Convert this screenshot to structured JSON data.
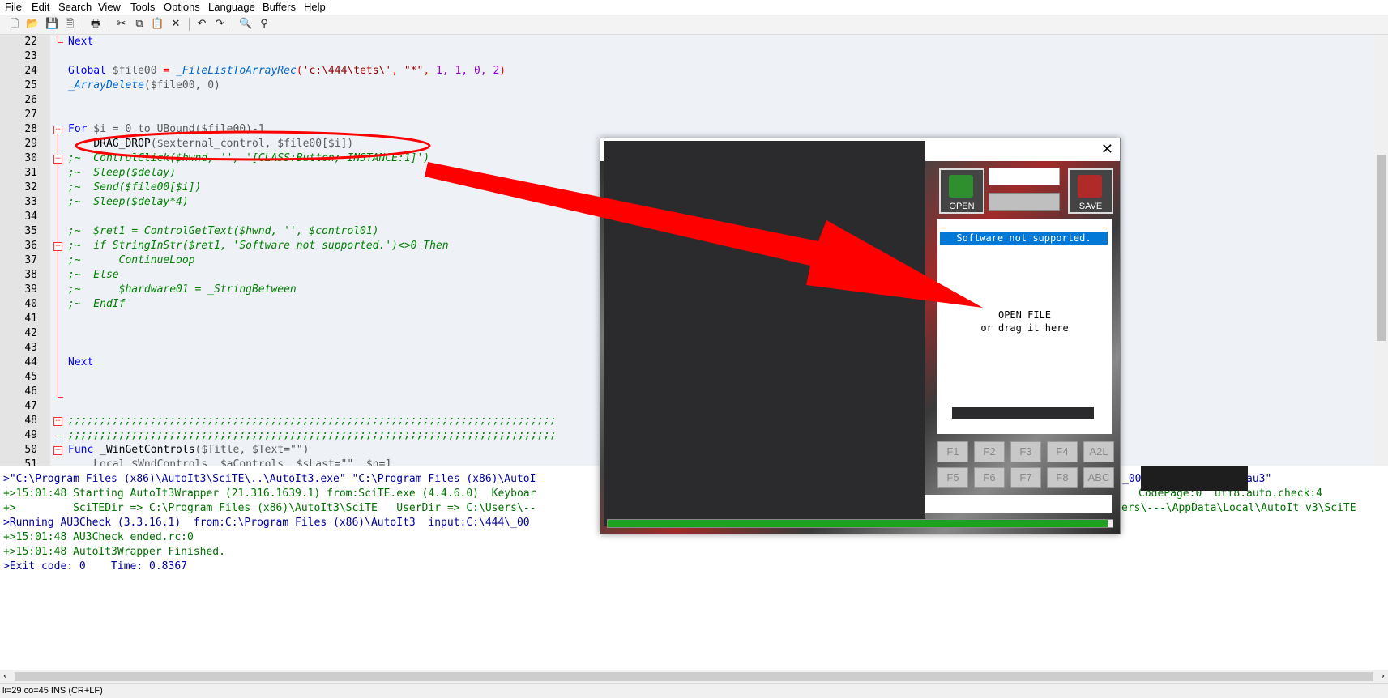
{
  "menu": [
    "File",
    "Edit",
    "Search",
    "View",
    "Tools",
    "Options",
    "Language",
    "Buffers",
    "Help"
  ],
  "toolbar_icons": [
    "new-file-icon",
    "open-folder-icon",
    "save-icon",
    "close-file-icon",
    "print-icon",
    "cut-icon",
    "copy-icon",
    "paste-icon",
    "delete-icon",
    "undo-icon",
    "redo-icon",
    "find-icon",
    "replace-icon"
  ],
  "editor": {
    "lines": [
      {
        "num": "22"
      },
      {
        "num": "23"
      },
      {
        "num": "24"
      },
      {
        "num": "25"
      },
      {
        "num": "26"
      },
      {
        "num": "27"
      },
      {
        "num": "28"
      },
      {
        "num": "29"
      },
      {
        "num": "30"
      },
      {
        "num": "31"
      },
      {
        "num": "32"
      },
      {
        "num": "33"
      },
      {
        "num": "34"
      },
      {
        "num": "35"
      },
      {
        "num": "36"
      },
      {
        "num": "37"
      },
      {
        "num": "38"
      },
      {
        "num": "39"
      },
      {
        "num": "40"
      },
      {
        "num": "41"
      },
      {
        "num": "42"
      },
      {
        "num": "43"
      },
      {
        "num": "44"
      },
      {
        "num": "45"
      },
      {
        "num": "46"
      },
      {
        "num": "47"
      },
      {
        "num": "48"
      },
      {
        "num": "49"
      },
      {
        "num": "50"
      },
      {
        "num": "51"
      }
    ],
    "code": {
      "l22": "Next",
      "l24_kw": "Global",
      "l24_var": " $file00 ",
      "l24_op": "=",
      "l24_fn": " _FileListToArrayRec",
      "l24_p1": "(",
      "l24_s1": "'c:\\444\\tets\\'",
      "l24_c1": ", ",
      "l24_s2": "\"*\"",
      "l24_c2": ", ",
      "l24_n": "1, 1, 0, 2",
      "l24_p2": ")",
      "l25_fn": "_ArrayDelete",
      "l25_rest": "($file00, 0)",
      "l28_kw": "For",
      "l28_rest": " $i = 0 to UBound($file00)-1",
      "l29_fn": "DRAG_DROP",
      "l29_rest": "($external_control, $file00[$i])",
      "l30": ";~  ControlClick($hwnd, '', '[CLASS:Button; INSTANCE:1]')",
      "l31": ";~  Sleep($delay)",
      "l32": ";~  Send($file00[$i])",
      "l33": ";~  Sleep($delay*4)",
      "l35": ";~  $ret1 = ControlGetText($hwnd, '', $control01)",
      "l36": ";~  if StringInStr($ret1, 'Software not supported.')<>0 Then",
      "l37": ";~      ContinueLoop",
      "l38": ";~  Else",
      "l39": ";~      $hardware01 = _StringBetween",
      "l40": ";~  EndIf",
      "l44": "Next",
      "l48": ";;;;;;;;;;;;;;;;;;;;;;;;;;;;;;;;;;;;;;;;;;;;;;;;;;;;;;;;;;;;;;;;;;;;;;;;;;;;;",
      "l49": ";;;;;;;;;;;;;;;;;;;;;;;;;;;;;;;;;;;;;;;;;;;;;;;;;;;;;;;;;;;;;;;;;;;;;;;;;;;;;",
      "l50_kw": "Func",
      "l50_fn": " _WinGetControls",
      "l50_rest": "($Title, $Text=\"\")",
      "l51": "    Local $WndControls, $aControls, $sLast=\"\", $n=1"
    }
  },
  "output": {
    "lines": [
      ">\"C:\\Program Files (x86)\\AutoIt3\\SciTE\\..\\AutoIt3.exe\" \"C:\\Program Files (x86)\\AutoI",
      "+>15:01:48 Starting AutoIt3Wrapper (21.316.1639.1) from:SciTE.exe (4.4.6.0)  Keyboar",
      "+>         SciTEDir => C:\\Program Files (x86)\\AutoIt3\\SciTE   UserDir => C:\\Users\\--",
      ">Running AU3Check (3.3.16.1)  from:C:\\Program Files (x86)\\AutoIt3  input:C:\\444\\_00",
      "+>15:01:48 AU3Check ended.rc:0",
      "+>15:01:48 AutoIt3Wrapper Finished.",
      ">Exit code: 0    Time: 0.8367"
    ],
    "right_fragments": [
      "_00",
      "au3\"",
      "CodePage:0  utf8.auto.check:4",
      "ers\\---\\AppData\\Local\\AutoIt v3\\SciTE"
    ]
  },
  "status": "li=29 co=45 INS (CR+LF)",
  "app": {
    "open_label": "OPEN",
    "save_label": "SAVE",
    "unsupported": "Software not supported.",
    "drop_line1": "OPEN FILE",
    "drop_line2": "or drag it here",
    "fkeys_row1": [
      "F1",
      "F2",
      "F3",
      "F4",
      "A2L"
    ],
    "fkeys_row2": [
      "F5",
      "F6",
      "F7",
      "F8",
      "ABC"
    ],
    "progress": 0.99
  },
  "colors": {
    "annotation_red": "#ff0000",
    "progress_green": "#1ea11e",
    "selection_blue": "#0078d7"
  }
}
